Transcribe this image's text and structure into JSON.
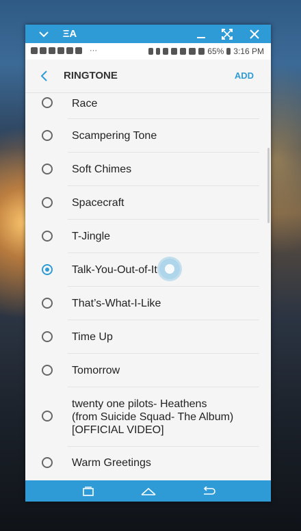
{
  "titlebar": {
    "app_glyph": "ΞA",
    "icons": [
      "chevron-down-icon",
      "app-icon",
      "minimize-icon",
      "expand-icon",
      "close-icon"
    ]
  },
  "statusbar": {
    "battery": "65%",
    "time": "3:16 PM",
    "more": "···"
  },
  "header": {
    "title": "RINGTONE",
    "add_label": "ADD"
  },
  "ringtones": {
    "items": [
      {
        "label": "Race",
        "selected": false
      },
      {
        "label": "Scampering Tone",
        "selected": false
      },
      {
        "label": "Soft Chimes",
        "selected": false
      },
      {
        "label": "Spacecraft",
        "selected": false
      },
      {
        "label": "T-Jingle",
        "selected": false
      },
      {
        "label": "Talk-You-Out-of-It",
        "selected": true
      },
      {
        "label": "That’s-What-I-Like",
        "selected": false
      },
      {
        "label": "Time Up",
        "selected": false
      },
      {
        "label": "Tomorrow",
        "selected": false
      },
      {
        "label_lines": [
          "twenty one pilots- Heathens",
          "(from Suicide Squad- The Album)",
          "[OFFICIAL VIDEO]"
        ],
        "selected": false
      },
      {
        "label": "Warm Greetings",
        "selected": false
      }
    ]
  },
  "colors": {
    "accent": "#2e9bd6",
    "background": "#f5f5f5",
    "text": "#222222"
  }
}
